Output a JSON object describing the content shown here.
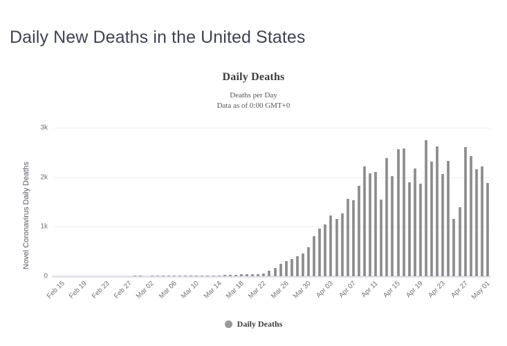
{
  "page": {
    "heading": "Daily New Deaths in the United States"
  },
  "chart": {
    "title": "Daily Deaths",
    "subtitle_line1": "Deaths per Day",
    "subtitle_line2": "Data as of 0:00 GMT+0",
    "legend": {
      "label": "Daily Deaths",
      "swatch_icon": "circle-icon",
      "color": "#999999"
    },
    "bar_color": "#8a8a8a",
    "gridline_color": "#eceef1",
    "baseline_color": "#dfe3ee"
  },
  "chart_data": {
    "type": "bar",
    "title": "Daily Deaths",
    "subtitle": "Deaths per Day / Data as of 0:00 GMT+0",
    "xlabel": "",
    "ylabel": "Novel Coronavirus Daily Deaths",
    "ylim": [
      0,
      3000
    ],
    "ytick_labels": [
      "0",
      "1k",
      "2k",
      "3k"
    ],
    "ytick_values": [
      0,
      1000,
      2000,
      3000
    ],
    "grid": true,
    "legend_position": "bottom",
    "xtick_labels": [
      "Feb 15",
      "Feb 19",
      "Feb 23",
      "Feb 27",
      "Mar 02",
      "Mar 06",
      "Mar 10",
      "Mar 14",
      "Mar 18",
      "Mar 22",
      "Mar 26",
      "Mar 30",
      "Apr 03",
      "Apr 07",
      "Apr 11",
      "Apr 15",
      "Apr 19",
      "Apr 23",
      "Apr 27",
      "May 01"
    ],
    "categories": [
      "Feb 15",
      "Feb 16",
      "Feb 17",
      "Feb 18",
      "Feb 19",
      "Feb 20",
      "Feb 21",
      "Feb 22",
      "Feb 23",
      "Feb 24",
      "Feb 25",
      "Feb 26",
      "Feb 27",
      "Feb 28",
      "Feb 29",
      "Mar 01",
      "Mar 02",
      "Mar 03",
      "Mar 04",
      "Mar 05",
      "Mar 06",
      "Mar 07",
      "Mar 08",
      "Mar 09",
      "Mar 10",
      "Mar 11",
      "Mar 12",
      "Mar 13",
      "Mar 14",
      "Mar 15",
      "Mar 16",
      "Mar 17",
      "Mar 18",
      "Mar 19",
      "Mar 20",
      "Mar 21",
      "Mar 22",
      "Mar 23",
      "Mar 24",
      "Mar 25",
      "Mar 26",
      "Mar 27",
      "Mar 28",
      "Mar 29",
      "Mar 30",
      "Mar 31",
      "Apr 01",
      "Apr 02",
      "Apr 03",
      "Apr 04",
      "Apr 05",
      "Apr 06",
      "Apr 07",
      "Apr 08",
      "Apr 09",
      "Apr 10",
      "Apr 11",
      "Apr 12",
      "Apr 13",
      "Apr 14",
      "Apr 15",
      "Apr 16",
      "Apr 17",
      "Apr 18",
      "Apr 19",
      "Apr 20",
      "Apr 21",
      "Apr 22",
      "Apr 23",
      "Apr 24",
      "Apr 25",
      "Apr 26",
      "Apr 27",
      "Apr 28",
      "Apr 29",
      "Apr 30",
      "May 01",
      "May 02"
    ],
    "series": [
      {
        "name": "Daily Deaths",
        "color": "#8a8a8a",
        "values": [
          0,
          0,
          0,
          0,
          0,
          0,
          0,
          0,
          0,
          0,
          0,
          0,
          0,
          0,
          1,
          1,
          0,
          6,
          2,
          2,
          3,
          4,
          3,
          4,
          4,
          7,
          9,
          11,
          8,
          10,
          22,
          24,
          33,
          41,
          49,
          46,
          45,
          63,
          112,
          163,
          246,
          304,
          350,
          403,
          467,
          582,
          810,
          960,
          1049,
          1229,
          1164,
          1268,
          1560,
          1535,
          1823,
          2219,
          2079,
          2114,
          1544,
          2393,
          2030,
          2572,
          2585,
          1891,
          2171,
          1873,
          2751,
          2314,
          2630,
          2067,
          2331,
          1154,
          1399,
          2611,
          2434,
          2164,
          2219,
          1884
        ]
      }
    ]
  }
}
